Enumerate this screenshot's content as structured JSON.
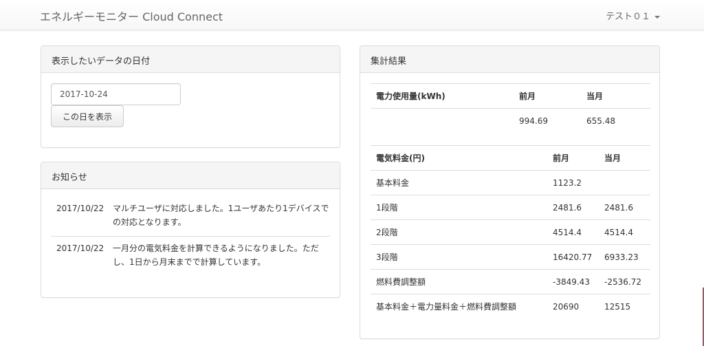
{
  "navbar": {
    "brand": "エネルギーモニター Cloud Connect",
    "user": "テスト０１"
  },
  "date_panel": {
    "title": "表示したいデータの日付",
    "date_value": "2017-10-24",
    "show_button": "この日を表示"
  },
  "news_panel": {
    "title": "お知らせ",
    "items": [
      {
        "date": "2017/10/22",
        "text": "マルチユーザに対応しました。1ユーザあたり1デバイスでの対応となります。"
      },
      {
        "date": "2017/10/22",
        "text": "一月分の電気料金を計算できるようになりました。ただし、1日から月末までで計算しています。"
      }
    ]
  },
  "result_panel": {
    "title": "集計結果",
    "power": {
      "headers": [
        "電力使用量(kWh)",
        "前月",
        "当月"
      ],
      "row": [
        "",
        "994.69",
        "655.48"
      ]
    },
    "fee": {
      "headers": [
        "電気料金(円)",
        "前月",
        "当月"
      ],
      "rows": [
        [
          "基本料金",
          "1123.2",
          ""
        ],
        [
          "1段階",
          "2481.6",
          "2481.6"
        ],
        [
          "2段階",
          "4514.4",
          "4514.4"
        ],
        [
          "3段階",
          "16420.77",
          "6933.23"
        ],
        [
          "燃料費調整額",
          "-3849.43",
          "-2536.72"
        ],
        [
          "基本料金＋電力量料金＋燃料費調整額",
          "20690",
          "12515"
        ]
      ]
    }
  }
}
